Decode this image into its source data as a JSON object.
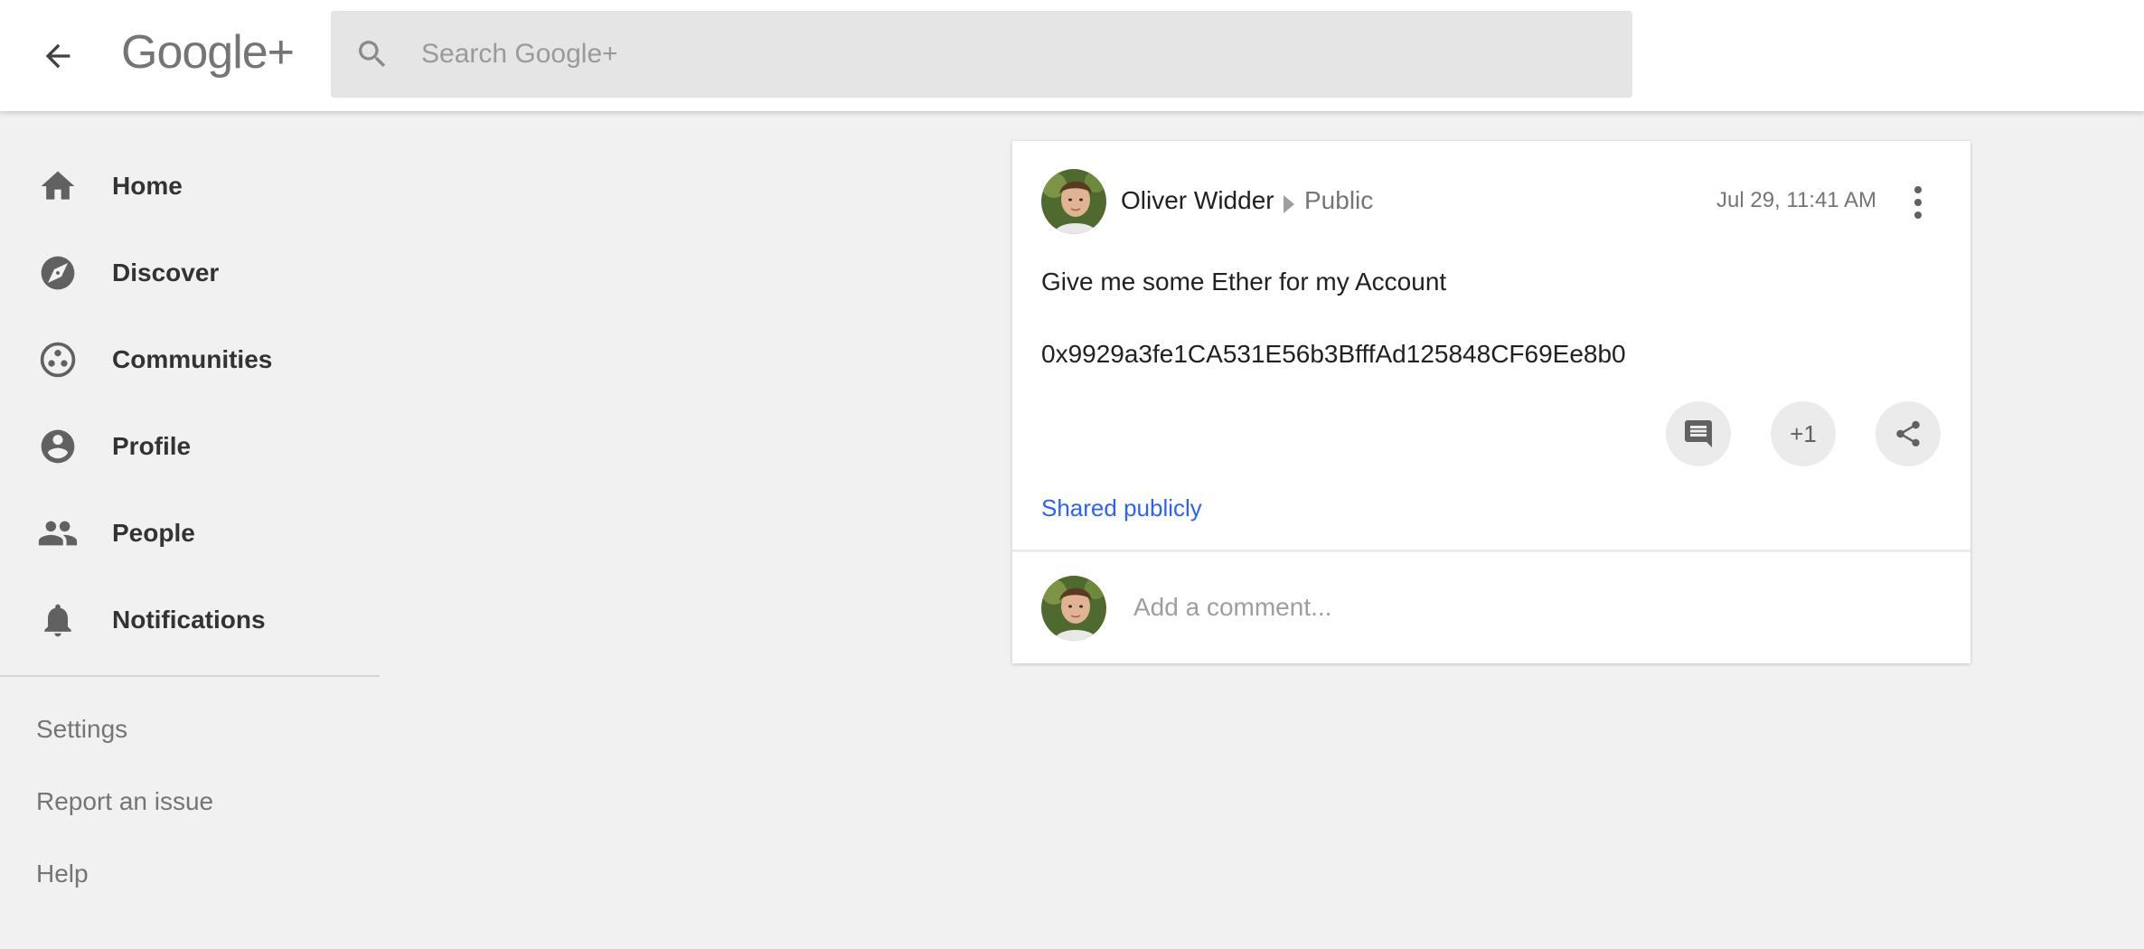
{
  "app": {
    "logo_text": "Google+"
  },
  "header": {
    "back_icon": "arrow-back-icon",
    "search_placeholder": "Search Google+",
    "search_value": ""
  },
  "sidebar": {
    "items": [
      {
        "label": "Home",
        "icon": "home-icon"
      },
      {
        "label": "Discover",
        "icon": "compass-icon"
      },
      {
        "label": "Communities",
        "icon": "communities-icon"
      },
      {
        "label": "Profile",
        "icon": "account-circle-icon"
      },
      {
        "label": "People",
        "icon": "people-icon"
      },
      {
        "label": "Notifications",
        "icon": "bell-icon"
      }
    ],
    "secondary": [
      {
        "label": "Settings"
      },
      {
        "label": "Report an issue"
      },
      {
        "label": "Help"
      }
    ]
  },
  "post": {
    "author": "Oliver Widder",
    "audience": "Public",
    "timestamp": "Jul 29, 11:41 AM",
    "text_line1": "Give me some Ether for my Account",
    "text_line2": "0x9929a3fe1CA531E56b3BfffAd125848CF69Ee8b0",
    "plus_one_label": "+1",
    "shared_label": "Shared publicly",
    "comment_placeholder": "Add a comment..."
  },
  "colors": {
    "background": "#f1f1f1",
    "card": "#ffffff",
    "link": "#2962ff",
    "icon_gray": "#616161"
  }
}
